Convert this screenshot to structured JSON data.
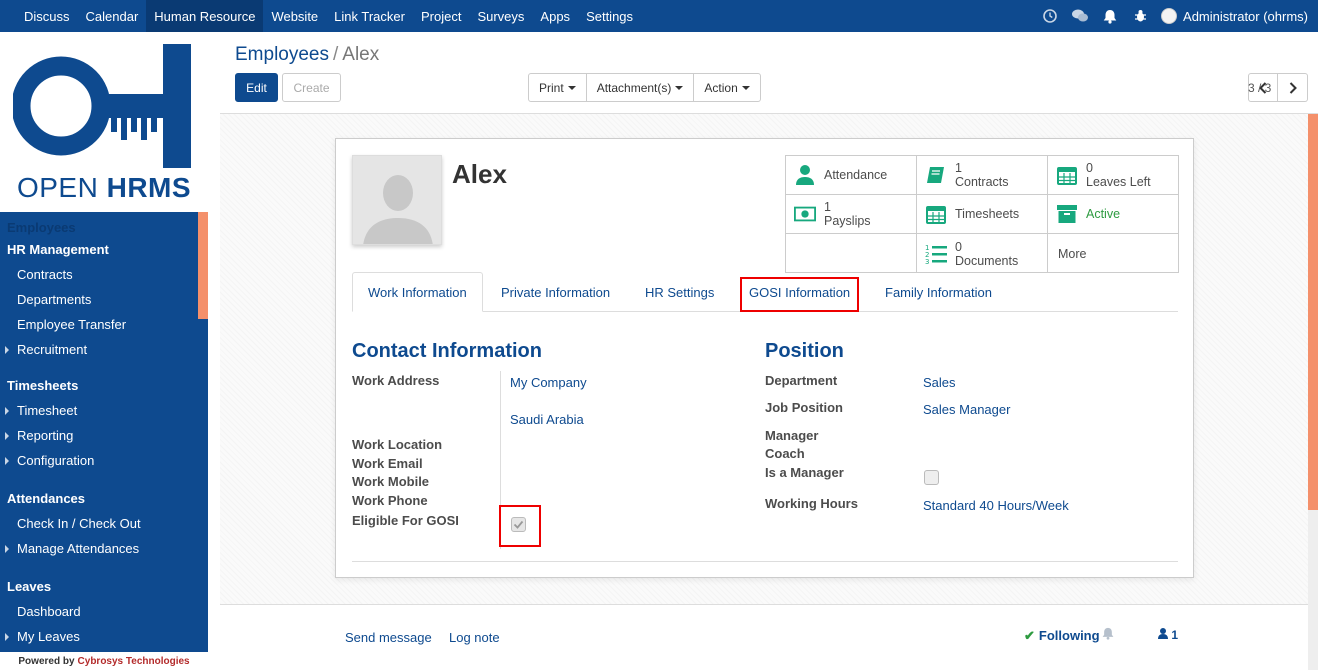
{
  "topbar": {
    "menu": [
      "Discuss",
      "Calendar",
      "Human Resource",
      "Website",
      "Link Tracker",
      "Project",
      "Surveys",
      "Apps",
      "Settings"
    ],
    "active_menu": "Human Resource",
    "user": "Administrator (ohrms)"
  },
  "sidebar": {
    "logo_text_light": "OPEN ",
    "logo_text_bold": "HRMS",
    "employees": "Employees",
    "hr_management": "HR Management",
    "contracts": "Contracts",
    "departments": "Departments",
    "employee_transfer": "Employee Transfer",
    "recruitment": "Recruitment",
    "timesheets_section": "Timesheets",
    "timesheet": "Timesheet",
    "reporting": "Reporting",
    "configuration": "Configuration",
    "attendances_section": "Attendances",
    "check_in_out": "Check In / Check Out",
    "manage_attendances": "Manage Attendances",
    "leaves_section": "Leaves",
    "dashboard": "Dashboard",
    "my_leaves": "My Leaves",
    "powered_by": "Powered by",
    "powered_company": "Cybrosys Technologies"
  },
  "control_panel": {
    "breadcrumb_parent": "Employees",
    "breadcrumb_current": "Alex",
    "edit_label": "Edit",
    "create_label": "Create",
    "print_label": "Print",
    "attachments_label": "Attachment(s)",
    "action_label": "Action",
    "pager": "3 / 3"
  },
  "employee": {
    "name": "Alex"
  },
  "stats": {
    "attendance": "Attendance",
    "contracts_count": "1",
    "contracts_label": "Contracts",
    "leaves_count": "0",
    "leaves_label": "Leaves Left",
    "payslips_count": "1",
    "payslips_label": "Payslips",
    "timesheets": "Timesheets",
    "active": "Active",
    "documents_count": "0",
    "documents_label": "Documents",
    "more": "More"
  },
  "tabs": [
    "Work Information",
    "Private Information",
    "HR Settings",
    "GOSI Information",
    "Family Information"
  ],
  "contact": {
    "heading": "Contact Information",
    "work_address_label": "Work Address",
    "work_address_company": "My Company",
    "work_address_country": "Saudi Arabia",
    "work_location_label": "Work Location",
    "work_email_label": "Work Email",
    "work_mobile_label": "Work Mobile",
    "work_phone_label": "Work Phone",
    "gosi_label": "Eligible For GOSI",
    "gosi_checked": true
  },
  "position": {
    "heading": "Position",
    "department_label": "Department",
    "department_value": "Sales",
    "job_label": "Job Position",
    "job_value": "Sales Manager",
    "manager_label": "Manager",
    "coach_label": "Coach",
    "is_manager_label": "Is a Manager",
    "is_manager_checked": false,
    "hours_label": "Working Hours",
    "hours_value": "Standard 40 Hours/Week"
  },
  "chatter": {
    "send_message": "Send message",
    "log_note": "Log note",
    "following": "Following",
    "followers": "1"
  },
  "colors": {
    "brand": "#0e4a8f",
    "accent_green": "#17a87e",
    "highlight_red": "#e00000",
    "sidebar_accent": "#f4906b"
  }
}
